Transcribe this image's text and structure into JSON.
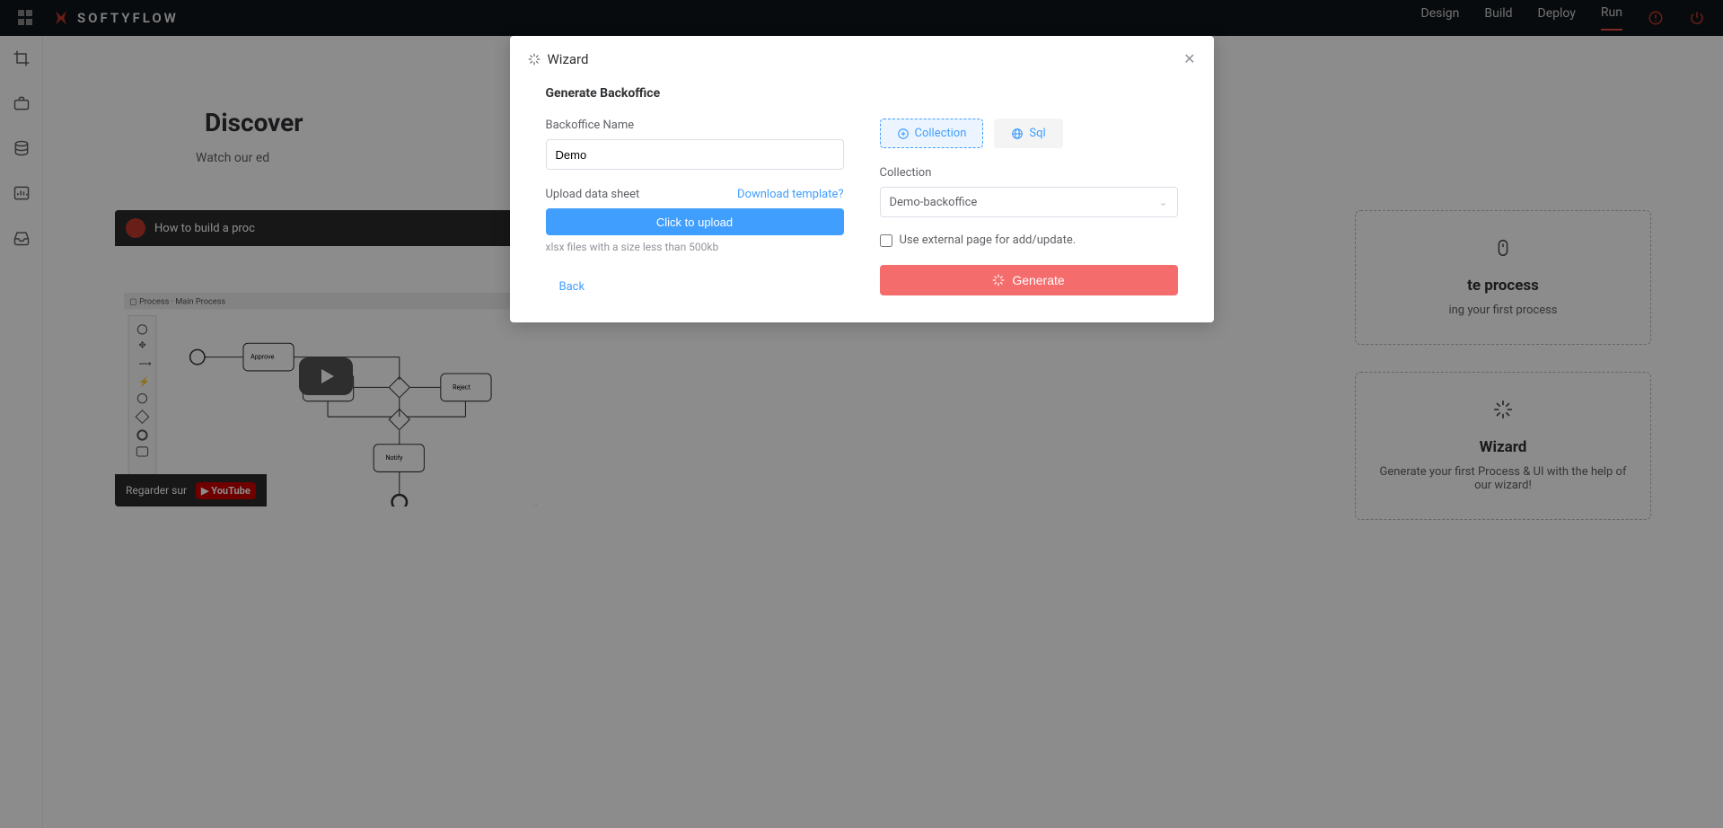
{
  "brand": "SOFTYFLOW",
  "nav": {
    "design": "Design",
    "build": "Build",
    "deploy": "Deploy",
    "run": "Run"
  },
  "hero": {
    "title": "Discover",
    "sub": "Watch our ed"
  },
  "video": {
    "title": "How to build a proc",
    "watch": "Regarder sur",
    "yt": "YouTube"
  },
  "cards": {
    "process": {
      "title": "te process",
      "desc": "ing your first process"
    },
    "wizard": {
      "title": "Wizard",
      "desc": "Generate your first Process & UI with the help of our wizard!"
    }
  },
  "modal": {
    "title": "Wizard",
    "heading": "Generate Backoffice",
    "name_label": "Backoffice Name",
    "name_value": "Demo",
    "upload_label": "Upload data sheet",
    "download_template": "Download template?",
    "upload_btn": "Click to upload",
    "upload_tip": "xlsx files with a size less than 500kb",
    "tab_collection": "Collection",
    "tab_sql": "Sql",
    "collection_label": "Collection",
    "collection_value": "Demo-backoffice",
    "external_page": "Use external page for add/update.",
    "generate": "Generate",
    "back": "Back"
  }
}
